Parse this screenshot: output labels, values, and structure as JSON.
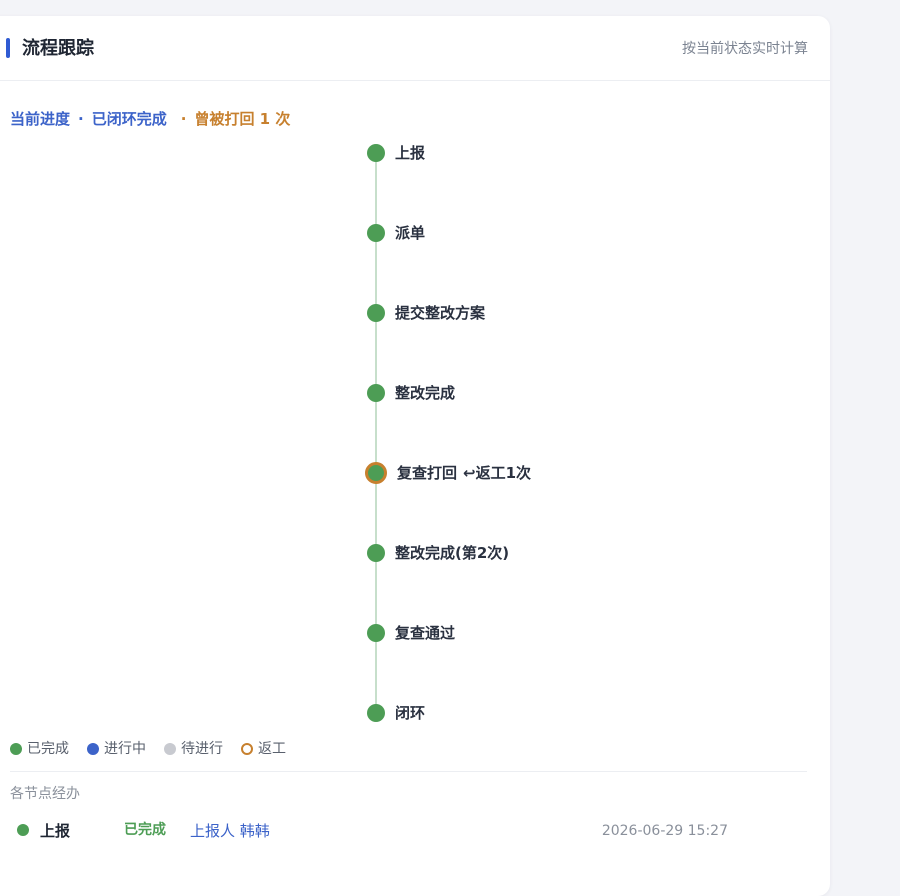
{
  "panel": {
    "title": "流程跟踪",
    "note": "按当前状态实时计算"
  },
  "progress": {
    "label": "当前进度",
    "separator": "·",
    "state": "已闭环完成",
    "rework_note": "曾被打回 1 次"
  },
  "timeline": {
    "nodes": [
      {
        "label": "上报",
        "status": "done",
        "extra": ""
      },
      {
        "label": "派单",
        "status": "done",
        "extra": ""
      },
      {
        "label": "提交整改方案",
        "status": "done",
        "extra": ""
      },
      {
        "label": "整改完成",
        "status": "done",
        "extra": ""
      },
      {
        "label": "复查打回",
        "status": "rework",
        "extra": "↩返工1次"
      },
      {
        "label": "整改完成(第2次)",
        "status": "done",
        "extra": ""
      },
      {
        "label": "复查通过",
        "status": "done",
        "extra": ""
      },
      {
        "label": "闭环",
        "status": "done",
        "extra": ""
      }
    ]
  },
  "legend": [
    {
      "label": "已完成",
      "kind": "done",
      "color": "#4d9d55"
    },
    {
      "label": "进行中",
      "kind": "active",
      "color": "#3c63c9"
    },
    {
      "label": "待进行",
      "kind": "pending",
      "color": "#c8cad0"
    },
    {
      "label": "返工",
      "kind": "rework",
      "color": "#c7802e"
    }
  ],
  "handlers": {
    "section_label": "各节点经办",
    "rows": [
      {
        "stage": "上报",
        "status": "已完成",
        "person": "上报人 韩韩",
        "time": "2026-06-29 15:27"
      }
    ]
  },
  "colors": {
    "accent": "#2f5bd3",
    "done": "#4d9d55",
    "rework": "#c7802e",
    "link": "#3c63c9"
  }
}
